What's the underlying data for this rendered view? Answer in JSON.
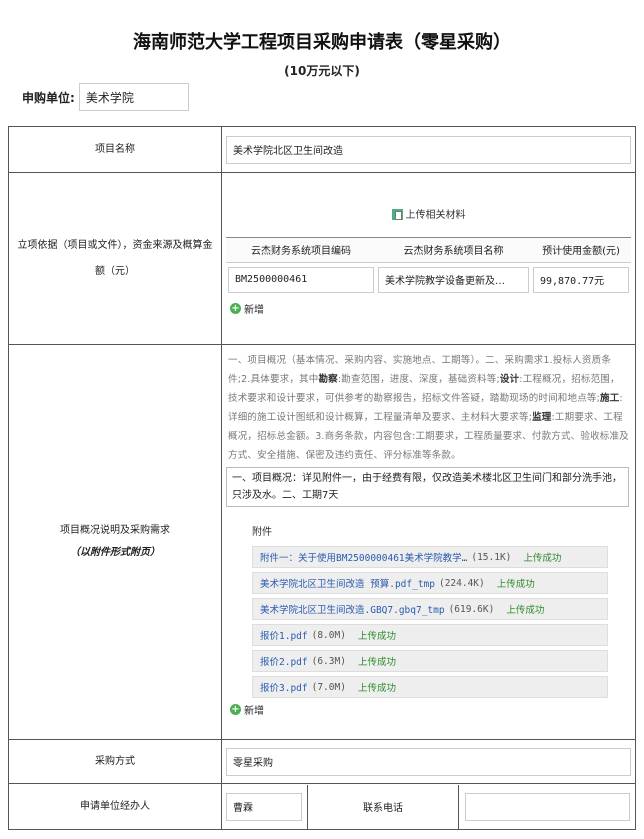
{
  "page": {
    "title": "海南师范大学工程项目采购申请表（零星采购）",
    "subtitle": "(10万元以下)"
  },
  "unit": {
    "label": "申购单位:",
    "value": "美术学院"
  },
  "project_name": {
    "label": "项目名称",
    "value": "美术学院北区卫生间改造"
  },
  "basis": {
    "label": "立项依据（项目或文件），资金来源及概算金额（元）",
    "upload_label": "上传相关材料",
    "columns": [
      "云杰财务系统项目编码",
      "云杰财务系统项目名称",
      "预计使用金额(元)"
    ],
    "rows": [
      {
        "code": "BM2500000461",
        "name": "美术学院教学设备更新及…",
        "amount": "99,870.77元"
      }
    ],
    "add_label": "新增"
  },
  "overview": {
    "label": "项目概况说明及采购需求",
    "sublabel": "（以附件形式附页）",
    "hint_parts": [
      "一、项目概况（基本情况、采购内容、实施地点、工期等）。二、采购需求1.投标人资质条件;2.具体要求，其中",
      "勘察",
      ":勘查范围，进度、深度，基础资料等;",
      "设计",
      ":工程概况，招标范围，技术要求和设计要求，可供参考的勘察报告，招标文件答疑，踏勘现场的时间和地点等;",
      "施工",
      ":详细的施工设计图纸和设计概算，工程量清单及要求、主材料大要求等;",
      "监理",
      ":工期要求、工程概况，招标总金额。3.商务条款，内容包含:工期要求，工程质量要求、付款方式、验收标准及方式、安全措施、保密及违约责任、评分标准等条款。"
    ],
    "content": "一、项目概况：详见附件一，由于经费有限，仅改造美术楼北区卫生间门和部分洗手池，只涉及水。二、工期7天",
    "attachments_title": "附件",
    "attachments": [
      {
        "name": "附件一：关于使用BM2500000461美术学院教学…",
        "size": "(15.1K)",
        "status": "上传成功"
      },
      {
        "name": "美术学院北区卫生间改造 预算.pdf_tmp",
        "size": "(224.4K)",
        "status": "上传成功"
      },
      {
        "name": "美术学院北区卫生间改造.GBQ7.gbq7_tmp",
        "size": "(619.6K)",
        "status": "上传成功"
      },
      {
        "name": "报价1.pdf",
        "size": "(8.0M)",
        "status": "上传成功"
      },
      {
        "name": "报价2.pdf",
        "size": "(6.3M)",
        "status": "上传成功"
      },
      {
        "name": "报价3.pdf",
        "size": "(7.0M)",
        "status": "上传成功"
      }
    ],
    "add_label": "新增"
  },
  "purchase_method": {
    "label": "采购方式",
    "value": "零星采购"
  },
  "handler": {
    "label": "申请单位经办人",
    "value": "曹霖",
    "phone_label": "联系电话",
    "phone_value": ""
  }
}
